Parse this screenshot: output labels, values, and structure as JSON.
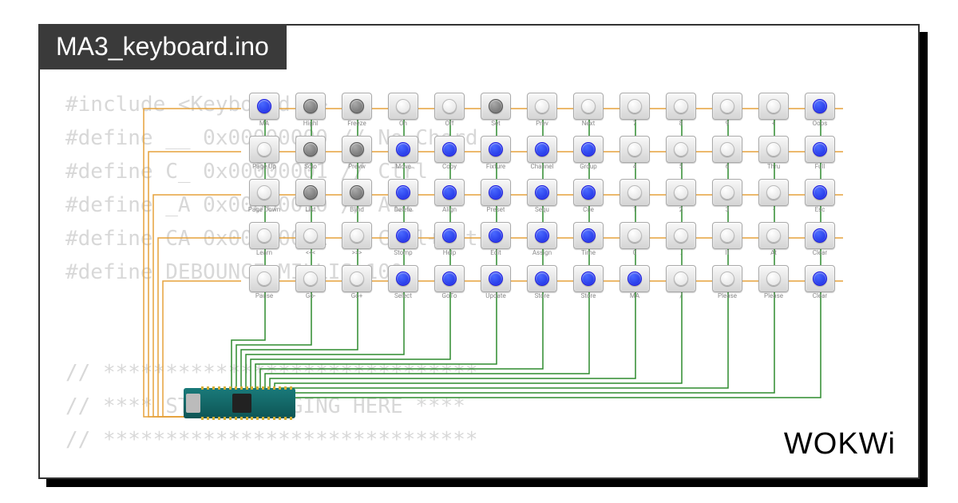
{
  "title": "MA3_keyboard.ino",
  "logo": "WOKWi",
  "code_lines": [
    "#include <Keyboard.h>",
    "#define __ 0x00000000 // No Chord",
    "#define C_ 0x00000001 // Ctrl",
    "#define _A 0x00000010 // Alt",
    "#define CA 0x00000011 // Ctrl+Alt",
    "#define DEBOUNCE_MILLIS 100",
    "",
    "",
    "// ******************************",
    "// **** START CHANGING HERE ****",
    "// ******************************"
  ],
  "keys": [
    [
      {
        "label": "MA",
        "c": "blue"
      },
      {
        "label": "Highl",
        "c": "grey"
      },
      {
        "label": "Freeze",
        "c": "grey"
      },
      {
        "label": "On",
        "c": "white"
      },
      {
        "label": "Off",
        "c": "white"
      },
      {
        "label": "Set",
        "c": "grey"
      },
      {
        "label": "Prev",
        "c": "white"
      },
      {
        "label": "Next",
        "c": "white"
      },
      {
        "label": "7",
        "c": "white"
      },
      {
        "label": "8",
        "c": "white"
      },
      {
        "label": "9",
        "c": "white"
      },
      {
        "label": "+",
        "c": "white"
      },
      {
        "label": "Oops",
        "c": "blue"
      }
    ],
    [
      {
        "label": "Page Up",
        "c": "white"
      },
      {
        "label": "Solo",
        "c": "grey"
      },
      {
        "label": "Prevw",
        "c": "grey"
      },
      {
        "label": "Move",
        "c": "blue"
      },
      {
        "label": "Copy",
        "c": "blue"
      },
      {
        "label": "Fixture",
        "c": "blue"
      },
      {
        "label": "Channel",
        "c": "blue"
      },
      {
        "label": "Group",
        "c": "blue"
      },
      {
        "label": "4",
        "c": "white"
      },
      {
        "label": "5",
        "c": "white"
      },
      {
        "label": "6",
        "c": "white"
      },
      {
        "label": "Thru",
        "c": "white"
      },
      {
        "label": "Full",
        "c": "blue"
      }
    ],
    [
      {
        "label": "Page Down",
        "c": "white"
      },
      {
        "label": "List",
        "c": "grey"
      },
      {
        "label": "Blind",
        "c": "grey"
      },
      {
        "label": "Delete",
        "c": "blue"
      },
      {
        "label": "Align",
        "c": "blue"
      },
      {
        "label": "Preset",
        "c": "blue"
      },
      {
        "label": "Sequ",
        "c": "blue"
      },
      {
        "label": "Cue",
        "c": "blue"
      },
      {
        "label": "1",
        "c": "white"
      },
      {
        "label": "2",
        "c": "white"
      },
      {
        "label": "3",
        "c": "white"
      },
      {
        "label": "-",
        "c": "white"
      },
      {
        "label": "Esc",
        "c": "blue"
      }
    ],
    [
      {
        "label": "Learn",
        "c": "white"
      },
      {
        "label": "<<<",
        "c": "white"
      },
      {
        "label": ">>>",
        "c": "white"
      },
      {
        "label": "Stomp",
        "c": "blue"
      },
      {
        "label": "Help",
        "c": "blue"
      },
      {
        "label": "Edit",
        "c": "blue"
      },
      {
        "label": "Assign",
        "c": "blue"
      },
      {
        "label": "Time",
        "c": "blue"
      },
      {
        "label": "0",
        "c": "white"
      },
      {
        "label": ".",
        "c": "white"
      },
      {
        "label": "If",
        "c": "white"
      },
      {
        "label": "At",
        "c": "white"
      },
      {
        "label": "Clear",
        "c": "blue"
      }
    ],
    [
      {
        "label": "Pause",
        "c": "white"
      },
      {
        "label": "Go-",
        "c": "white"
      },
      {
        "label": "Go+",
        "c": "white"
      },
      {
        "label": "Select",
        "c": "blue"
      },
      {
        "label": "GoTo",
        "c": "blue"
      },
      {
        "label": "Update",
        "c": "blue"
      },
      {
        "label": "Store",
        "c": "blue"
      },
      {
        "label": "Store",
        "c": "blue"
      },
      {
        "label": "MA",
        "c": "blue"
      },
      {
        "label": "/",
        "c": "white"
      },
      {
        "label": "Please",
        "c": "white"
      },
      {
        "label": "Please",
        "c": "white"
      },
      {
        "label": "Clear",
        "c": "blue"
      }
    ]
  ],
  "mcu_name": "Arduino Micro"
}
